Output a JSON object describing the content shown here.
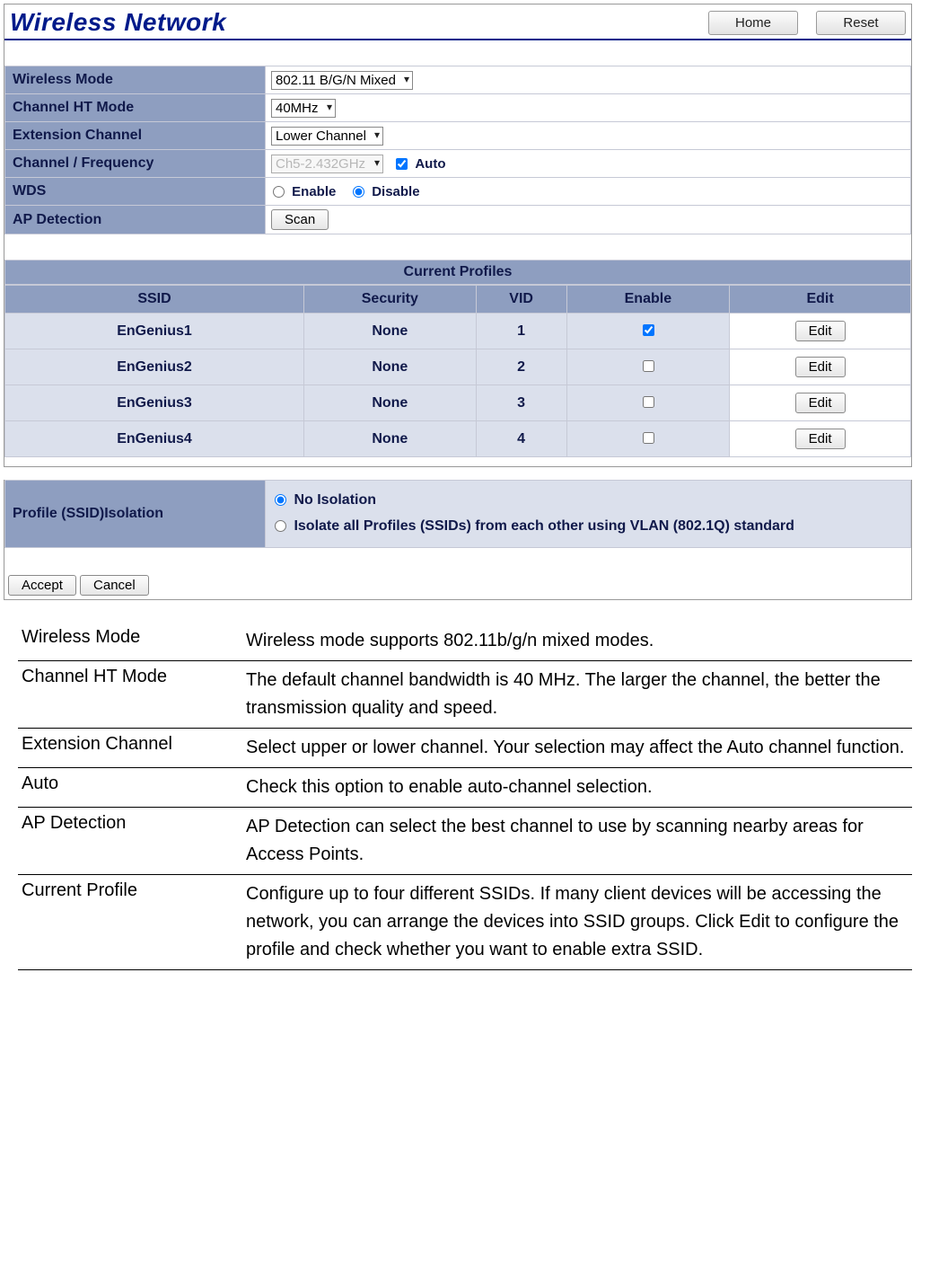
{
  "header": {
    "title": "Wireless Network",
    "home": "Home",
    "reset": "Reset"
  },
  "settings": {
    "wireless_mode": {
      "label": "Wireless Mode",
      "value": "802.11 B/G/N Mixed"
    },
    "channel_ht": {
      "label": "Channel HT Mode",
      "value": "40MHz"
    },
    "ext_channel": {
      "label": "Extension Channel",
      "value": "Lower Channel"
    },
    "chan_freq": {
      "label": "Channel / Frequency",
      "value": "Ch5-2.432GHz",
      "auto_label": "Auto",
      "auto_checked": true
    },
    "wds": {
      "label": "WDS",
      "enable": "Enable",
      "disable": "Disable",
      "selected": "disable"
    },
    "ap_detect": {
      "label": "AP Detection",
      "scan": "Scan"
    }
  },
  "profiles": {
    "title": "Current Profiles",
    "cols": {
      "ssid": "SSID",
      "security": "Security",
      "vid": "VID",
      "enable": "Enable",
      "edit": "Edit"
    },
    "edit_btn": "Edit",
    "rows": [
      {
        "ssid": "EnGenius1",
        "security": "None",
        "vid": "1",
        "enabled": true
      },
      {
        "ssid": "EnGenius2",
        "security": "None",
        "vid": "2",
        "enabled": false
      },
      {
        "ssid": "EnGenius3",
        "security": "None",
        "vid": "3",
        "enabled": false
      },
      {
        "ssid": "EnGenius4",
        "security": "None",
        "vid": "4",
        "enabled": false
      }
    ]
  },
  "isolation": {
    "label": "Profile (SSID)Isolation",
    "opt1": "No Isolation",
    "opt2": "Isolate all Profiles (SSIDs) from each other using VLAN (802.1Q) standard",
    "selected": "opt1"
  },
  "buttons": {
    "accept": "Accept",
    "cancel": "Cancel"
  },
  "descriptions": [
    {
      "term": "Wireless Mode",
      "def": "Wireless mode supports 802.11b/g/n mixed modes."
    },
    {
      "term": "Channel HT Mode",
      "def": "The default channel bandwidth is 40 MHz. The larger the channel, the better the transmission quality and speed."
    },
    {
      "term": "Extension Channel",
      "def": "Select upper or lower channel. Your selection may affect the Auto channel function."
    },
    {
      "term": "Auto",
      "def": "Check this option to enable auto-channel selection."
    },
    {
      "term": "AP Detection",
      "def": "AP Detection can select the best channel to use by scanning nearby areas for Access Points."
    },
    {
      "term": "Current Profile",
      "def": "Configure up to four different SSIDs. If many client devices will be accessing the network, you can arrange the devices into SSID groups. Click Edit to configure the profile and check whether you want to enable extra SSID."
    }
  ]
}
